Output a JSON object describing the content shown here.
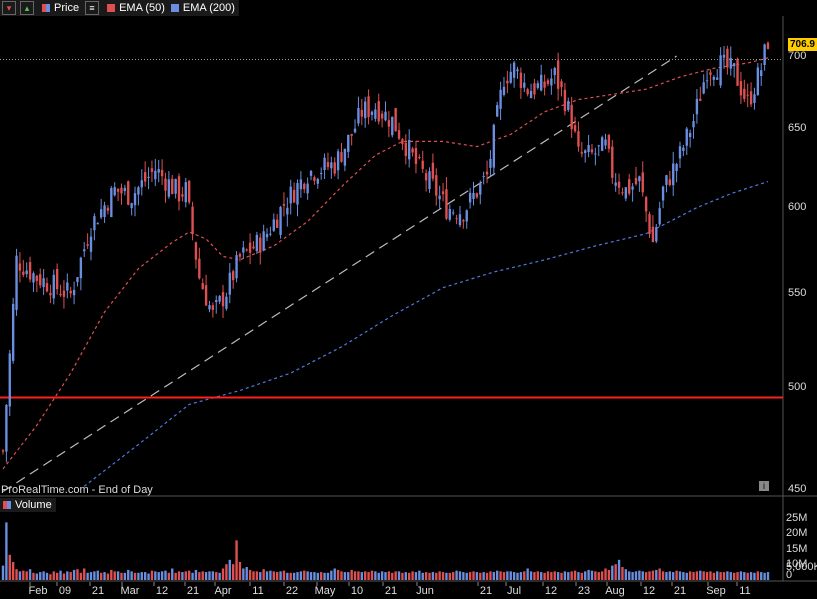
{
  "legend": {
    "price_label": "Price",
    "ema50_label": "EMA (50)",
    "ema200_label": "EMA (200)"
  },
  "volume_label": "Volume",
  "footer_text": "ProRealTime.com - End of Day",
  "last_price_label": "706.9",
  "colors": {
    "up": "#6a8fe0",
    "down": "#e05050",
    "ema50": "#e05050",
    "ema200": "#4f78e0",
    "trendline": "#bbbbbb",
    "hline": "#ff2020",
    "background": "#000000"
  },
  "chart_data": {
    "type": "candlestick",
    "y_ticks": [
      "700",
      "650",
      "600",
      "550",
      "500",
      "450"
    ],
    "x_ticks": [
      "Feb",
      "09",
      "21",
      "Mar",
      "12",
      "21",
      "Apr",
      "11",
      "22",
      "May",
      "10",
      "21",
      "Jun",
      "21",
      "Jul",
      "12",
      "23",
      "Aug",
      "12",
      "21",
      "Sep",
      "11"
    ],
    "volume_ticks": [
      "25M",
      "20M",
      "15M",
      "10M",
      "5,000K",
      "0"
    ],
    "ylim": [
      445,
      720
    ],
    "horizontal_line": 501,
    "dotted_price_line": 695,
    "price_path": [
      [
        0,
        470
      ],
      [
        4,
        580
      ],
      [
        10,
        570
      ],
      [
        20,
        560
      ],
      [
        26,
        600
      ],
      [
        33,
        620
      ],
      [
        38,
        617
      ],
      [
        45,
        632
      ],
      [
        52,
        618
      ],
      [
        54,
        620
      ],
      [
        58,
        570
      ],
      [
        62,
        548
      ],
      [
        66,
        562
      ],
      [
        70,
        581
      ],
      [
        77,
        592
      ],
      [
        83,
        612
      ],
      [
        90,
        630
      ],
      [
        98,
        635
      ],
      [
        103,
        652
      ],
      [
        106,
        665
      ],
      [
        110,
        668
      ],
      [
        115,
        660
      ],
      [
        118,
        650
      ],
      [
        122,
        635
      ],
      [
        127,
        622
      ],
      [
        131,
        610
      ],
      [
        136,
        608
      ],
      [
        143,
        628
      ],
      [
        148,
        685
      ],
      [
        151,
        690
      ],
      [
        155,
        678
      ],
      [
        160,
        680
      ],
      [
        163,
        686
      ],
      [
        166,
        672
      ],
      [
        168,
        660
      ],
      [
        170,
        640
      ],
      [
        174,
        640
      ],
      [
        178,
        645
      ],
      [
        180,
        630
      ],
      [
        184,
        620
      ],
      [
        188,
        625
      ],
      [
        192,
        590
      ],
      [
        195,
        620
      ],
      [
        200,
        640
      ],
      [
        204,
        660
      ],
      [
        208,
        690
      ],
      [
        212,
        692
      ],
      [
        216,
        688
      ],
      [
        220,
        670
      ],
      [
        224,
        690
      ],
      [
        226,
        706
      ]
    ],
    "ema50_path": [
      [
        0,
        460
      ],
      [
        10,
        485
      ],
      [
        20,
        515
      ],
      [
        30,
        550
      ],
      [
        40,
        575
      ],
      [
        50,
        590
      ],
      [
        55,
        596
      ],
      [
        60,
        592
      ],
      [
        65,
        582
      ],
      [
        70,
        580
      ],
      [
        80,
        588
      ],
      [
        90,
        602
      ],
      [
        100,
        622
      ],
      [
        110,
        640
      ],
      [
        118,
        648
      ],
      [
        130,
        648
      ],
      [
        140,
        645
      ],
      [
        150,
        652
      ],
      [
        160,
        665
      ],
      [
        170,
        672
      ],
      [
        180,
        675
      ],
      [
        190,
        678
      ],
      [
        200,
        685
      ],
      [
        210,
        690
      ],
      [
        220,
        693
      ],
      [
        226,
        696
      ]
    ],
    "ema200_path": [
      [
        24,
        450
      ],
      [
        40,
        474
      ],
      [
        55,
        497
      ],
      [
        70,
        505
      ],
      [
        85,
        515
      ],
      [
        100,
        530
      ],
      [
        115,
        548
      ],
      [
        130,
        564
      ],
      [
        145,
        573
      ],
      [
        160,
        580
      ],
      [
        175,
        588
      ],
      [
        190,
        595
      ],
      [
        205,
        610
      ],
      [
        215,
        618
      ],
      [
        226,
        625
      ]
    ],
    "trendline_points": [
      [
        0,
        447
      ],
      [
        199,
        697
      ]
    ],
    "volume_level": [
      0.2,
      0.8,
      0.35,
      0.25,
      0.15,
      0.12,
      0.13,
      0.12,
      0.15,
      0.1,
      0.09,
      0.11,
      0.12,
      0.1,
      0.08,
      0.12,
      0.1,
      0.13,
      0.09,
      0.12,
      0.11,
      0.14,
      0.15,
      0.1,
      0.16,
      0.1,
      0.11,
      0.12,
      0.13,
      0.1,
      0.11,
      0.09,
      0.14,
      0.12,
      0.12,
      0.1,
      0.1,
      0.14,
      0.12,
      0.1,
      0.1,
      0.11,
      0.11,
      0.09,
      0.13,
      0.12,
      0.11,
      0.12,
      0.13,
      0.1,
      0.16,
      0.1,
      0.12,
      0.11,
      0.12,
      0.13,
      0.1,
      0.14,
      0.11,
      0.12,
      0.11,
      0.12,
      0.12,
      0.11,
      0.1,
      0.16,
      0.22,
      0.28,
      0.22,
      0.55,
      0.25,
      0.16,
      0.18,
      0.14,
      0.12,
      0.12,
      0.11,
      0.15,
      0.12,
      0.13,
      0.12,
      0.11,
      0.12,
      0.13,
      0.1,
      0.1,
      0.1,
      0.11,
      0.12,
      0.13,
      0.12,
      0.11,
      0.11,
      0.1,
      0.11,
      0.1,
      0.1,
      0.13,
      0.16,
      0.14,
      0.12,
      0.11,
      0.11,
      0.14,
      0.12,
      0.12,
      0.11,
      0.12,
      0.11,
      0.13,
      0.12,
      0.1,
      0.12,
      0.11,
      0.12,
      0.1,
      0.12,
      0.12,
      0.1,
      0.11,
      0.1,
      0.12,
      0.11,
      0.13,
      0.1,
      0.11,
      0.1,
      0.11,
      0.1,
      0.12,
      0.11,
      0.1,
      0.1,
      0.11,
      0.13,
      0.12,
      0.11,
      0.1,
      0.11,
      0.12,
      0.11,
      0.1,
      0.11,
      0.1,
      0.12,
      0.11,
      0.13,
      0.12,
      0.11,
      0.12,
      0.12,
      0.11,
      0.1,
      0.11,
      0.12,
      0.16,
      0.12,
      0.11,
      0.12,
      0.11,
      0.1,
      0.12,
      0.11,
      0.12,
      0.11,
      0.1,
      0.12,
      0.11,
      0.12,
      0.13,
      0.11,
      0.1,
      0.12,
      0.14,
      0.13,
      0.12,
      0.11,
      0.12,
      0.16,
      0.14,
      0.2,
      0.22,
      0.28,
      0.18,
      0.15,
      0.12,
      0.11,
      0.12,
      0.13,
      0.12,
      0.11,
      0.12,
      0.13,
      0.14,
      0.16,
      0.12,
      0.11,
      0.12,
      0.11,
      0.13,
      0.12,
      0.11,
      0.1,
      0.12,
      0.11,
      0.12,
      0.13,
      0.12,
      0.11,
      0.12,
      0.1,
      0.12,
      0.11,
      0.11,
      0.12,
      0.11,
      0.1,
      0.11,
      0.12,
      0.11,
      0.1,
      0.11,
      0.1,
      0.12,
      0.11,
      0.1,
      0.11
    ]
  }
}
